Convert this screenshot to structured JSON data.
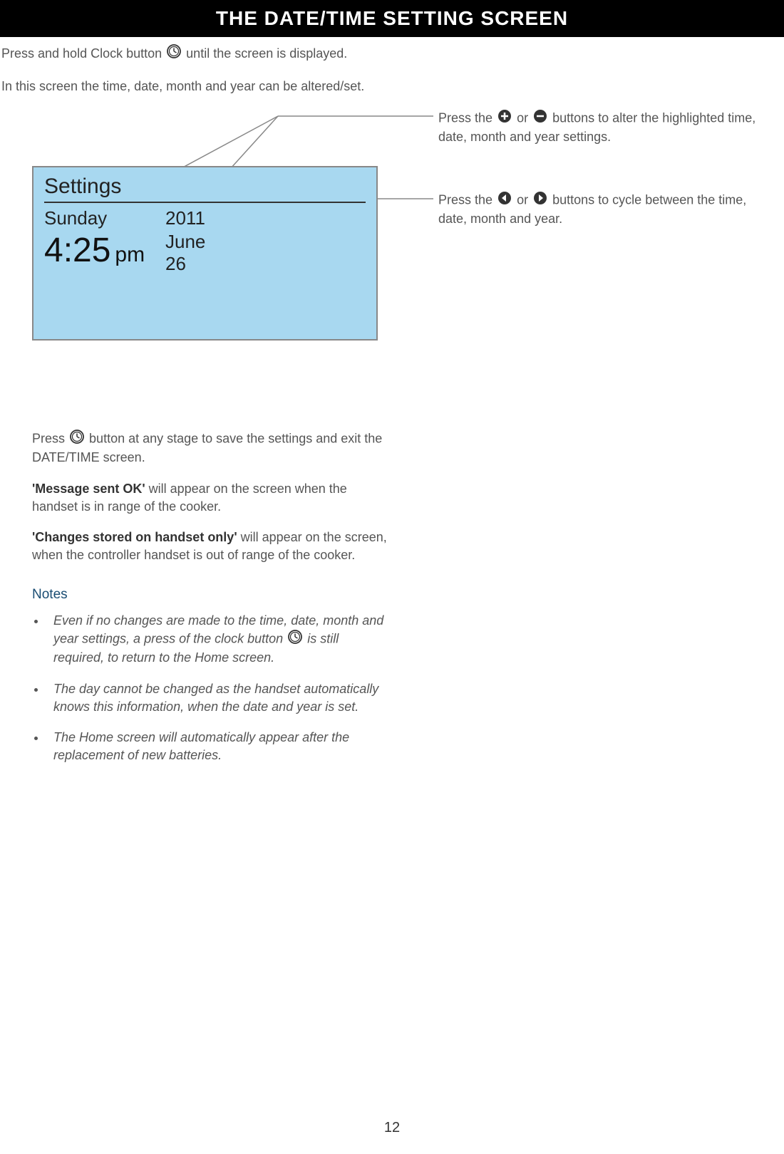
{
  "header": "THE DATE/TIME SETTING SCREEN",
  "intro": {
    "line1a": "Press and hold Clock button",
    "line1b": "until the screen is displayed.",
    "line2": "In this screen the time, date, month and year can be altered/set."
  },
  "callouts": {
    "c1a": "Press the",
    "c1b": "or",
    "c1c": "buttons to alter the highlighted time, date, month and year settings.",
    "c2a": "Press the",
    "c2b": "or",
    "c2c": "buttons to cycle between the time, date, month and year."
  },
  "device": {
    "title": "Settings",
    "day": "Sunday",
    "time": "4:25",
    "ampm": "pm",
    "year": "2011",
    "month": "June",
    "daynum": "26"
  },
  "bottom": {
    "p1a": "Press",
    "p1b": "button at any stage to save the settings and exit the DATE/TIME screen.",
    "p2bold": "'Message sent OK'",
    "p2rest": " will appear on the screen when the handset is in range of the cooker.",
    "p3bold": "'Changes stored on handset only'",
    "p3rest": " will appear on the screen, when the controller handset is out of range of the cooker."
  },
  "notes": {
    "heading": "Notes",
    "n1a": "Even if no changes are made to the time, date, month and year settings, a press of the clock button",
    "n1b": "is still required, to return to the Home screen.",
    "n2": "The day cannot be changed as the handset automatically knows this information, when the date and year is set.",
    "n3": "The Home screen will automatically appear after the replacement of new batteries."
  },
  "page": "12"
}
